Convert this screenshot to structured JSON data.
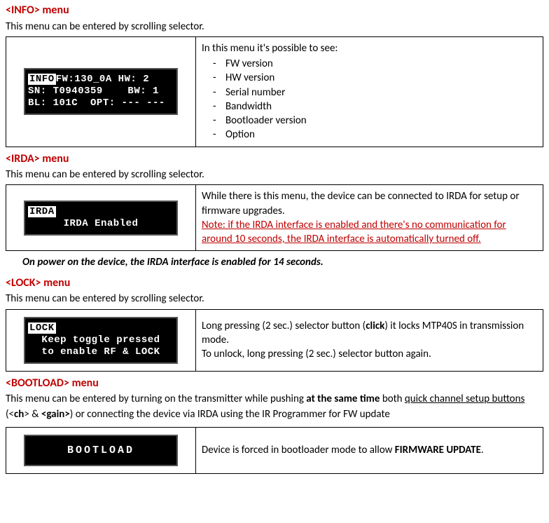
{
  "info": {
    "title": "<INFO> menu",
    "desc": "This menu can be entered by scrolling selector.",
    "lcd": {
      "tag": "INFO",
      "line1_rest": "FW:130_0A HW: 2",
      "line2": "SN: T0940359    BW: 1",
      "line3": "BL: 101C  OPT: --- ---"
    },
    "intro": "In this menu it's possible to see:",
    "items": [
      "FW version",
      "HW version",
      "Serial number",
      "Bandwidth",
      "Bootloader version",
      "Option"
    ]
  },
  "irda": {
    "title": "<IRDA> menu",
    "desc": "This menu can be entered by scrolling selector.",
    "lcd": {
      "tag": "IRDA",
      "line2": "IRDA Enabled"
    },
    "text1": "While there is this menu, the device can be connected to IRDA for setup or firmware upgrades.",
    "note": "Note: if the IRDA interface is enabled and there's no communication for around 10 seconds, the IRDA interface is automatically turned off.",
    "power_note": "On power on the device, the IRDA interface is enabled for 14 seconds."
  },
  "lock": {
    "title": "<LOCK> menu",
    "desc": "This menu can be entered by scrolling selector.",
    "lcd": {
      "tag": "LOCK",
      "line2": "Keep toggle pressed",
      "line3": "to enable RF & LOCK"
    },
    "text_pre": "Long pressing (2 sec.) selector button (",
    "text_bold": "click",
    "text_mid": ") it locks MTP40S in transmission mode.",
    "text2": "To unlock, long pressing (2 sec.) selector button again."
  },
  "bootload": {
    "title": "<BOOTLOAD> menu",
    "desc_parts": {
      "p1": "This menu can be entered by turning on the transmitter while pushing ",
      "b1": "at the same time",
      "p2": " both ",
      "u1": "quick channel setup buttons",
      "p3": " (<",
      "b2": "ch",
      "p4": "> & ",
      "b3": "<gain>",
      "p5": ") or connecting the device via IRDA using the IR Programmer for FW update"
    },
    "lcd_text": "BOOTLOAD",
    "text_pre": "Device is forced in bootloader mode to allow ",
    "text_bold": "FIRMWARE UPDATE",
    "text_post": "."
  }
}
